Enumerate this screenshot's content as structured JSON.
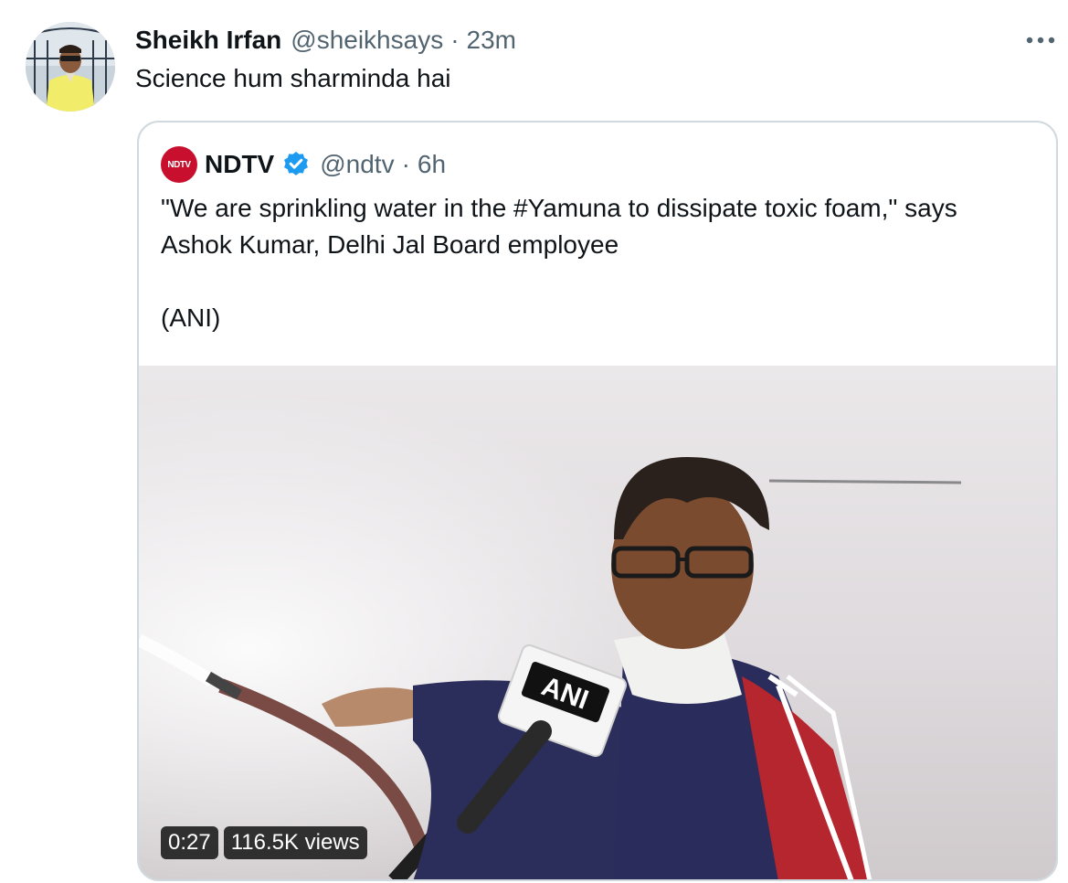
{
  "tweet": {
    "author_name": "Sheikh Irfan",
    "author_handle": "@sheikhsays",
    "separator": "·",
    "timestamp": "23m",
    "text": "Science hum sharminda hai",
    "more_icon": "more-horizontal-icon"
  },
  "quoted_tweet": {
    "logo_text": "NDTV",
    "author_name": "NDTV",
    "verified": true,
    "verified_icon": "verified-badge-icon",
    "author_handle": "@ndtv",
    "separator": "·",
    "timestamp": "6h",
    "text_line1": "\"We are sprinkling water in the #Yamuna to dissipate toxic foam,\" says",
    "text_line2": "Ashok Kumar, Delhi Jal Board employee",
    "text_line3": "(ANI)",
    "media": {
      "type": "video",
      "mic_label": "ANI",
      "duration": "0:27",
      "views": "116.5K views"
    }
  },
  "colors": {
    "text_primary": "#0f1419",
    "text_secondary": "#536471",
    "border": "#cfd9de",
    "verified_blue": "#1d9bf0",
    "ndtv_red": "#c8102e"
  }
}
